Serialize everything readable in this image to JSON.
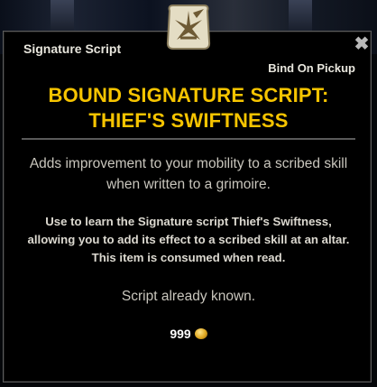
{
  "tooltip": {
    "item_type": "Signature Script",
    "close_glyph": "✖",
    "bind_note": "Bind On Pickup",
    "title": "BOUND SIGNATURE SCRIPT: THIEF'S SWIFTNESS",
    "description": "Adds improvement to your mobility to a scribed skill when written to a grimoire.",
    "use_text": "Use to learn the Signature script Thief's Swiftness, allowing you to add its effect to a scribed skill at an altar. This item is consumed when read.",
    "status": "Script already known.",
    "price": "999",
    "price_icon": "gold-coin-icon",
    "emblem_icon": "signature-script-emblem-icon"
  },
  "colors": {
    "title": "#f6c400",
    "background": "#000000",
    "border": "#5c5c5c",
    "body_text": "#c9c6bd"
  }
}
